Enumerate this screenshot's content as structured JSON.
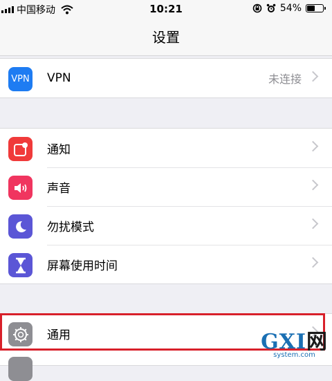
{
  "status_bar": {
    "carrier": "中国移动",
    "time": "10:21",
    "battery_percent": "54%",
    "battery_level": 0.54,
    "icons": [
      "signal-icon",
      "wifi-icon",
      "orientation-lock-icon",
      "alarm-icon",
      "battery-icon"
    ]
  },
  "nav": {
    "title": "设置"
  },
  "groups": [
    {
      "items": [
        {
          "label": "VPN",
          "icon_text": "VPN",
          "value": "未连接",
          "icon_color": "#1e7cf2"
        }
      ]
    },
    {
      "items": [
        {
          "label": "通知",
          "icon": "notifications-icon",
          "icon_color": "#f03a3a"
        },
        {
          "label": "声音",
          "icon": "sound-icon",
          "icon_color": "#f0355f"
        },
        {
          "label": "勿扰模式",
          "icon": "moon-icon",
          "icon_color": "#5b56d6"
        },
        {
          "label": "屏幕使用时间",
          "icon": "hourglass-icon",
          "icon_color": "#5b56d6"
        }
      ]
    },
    {
      "items": [
        {
          "label": "通用",
          "icon": "gear-icon",
          "icon_color": "#8e8e93"
        }
      ]
    }
  ],
  "watermark": {
    "main_left": "GXI",
    "main_right": "网",
    "sub": "system.com"
  }
}
